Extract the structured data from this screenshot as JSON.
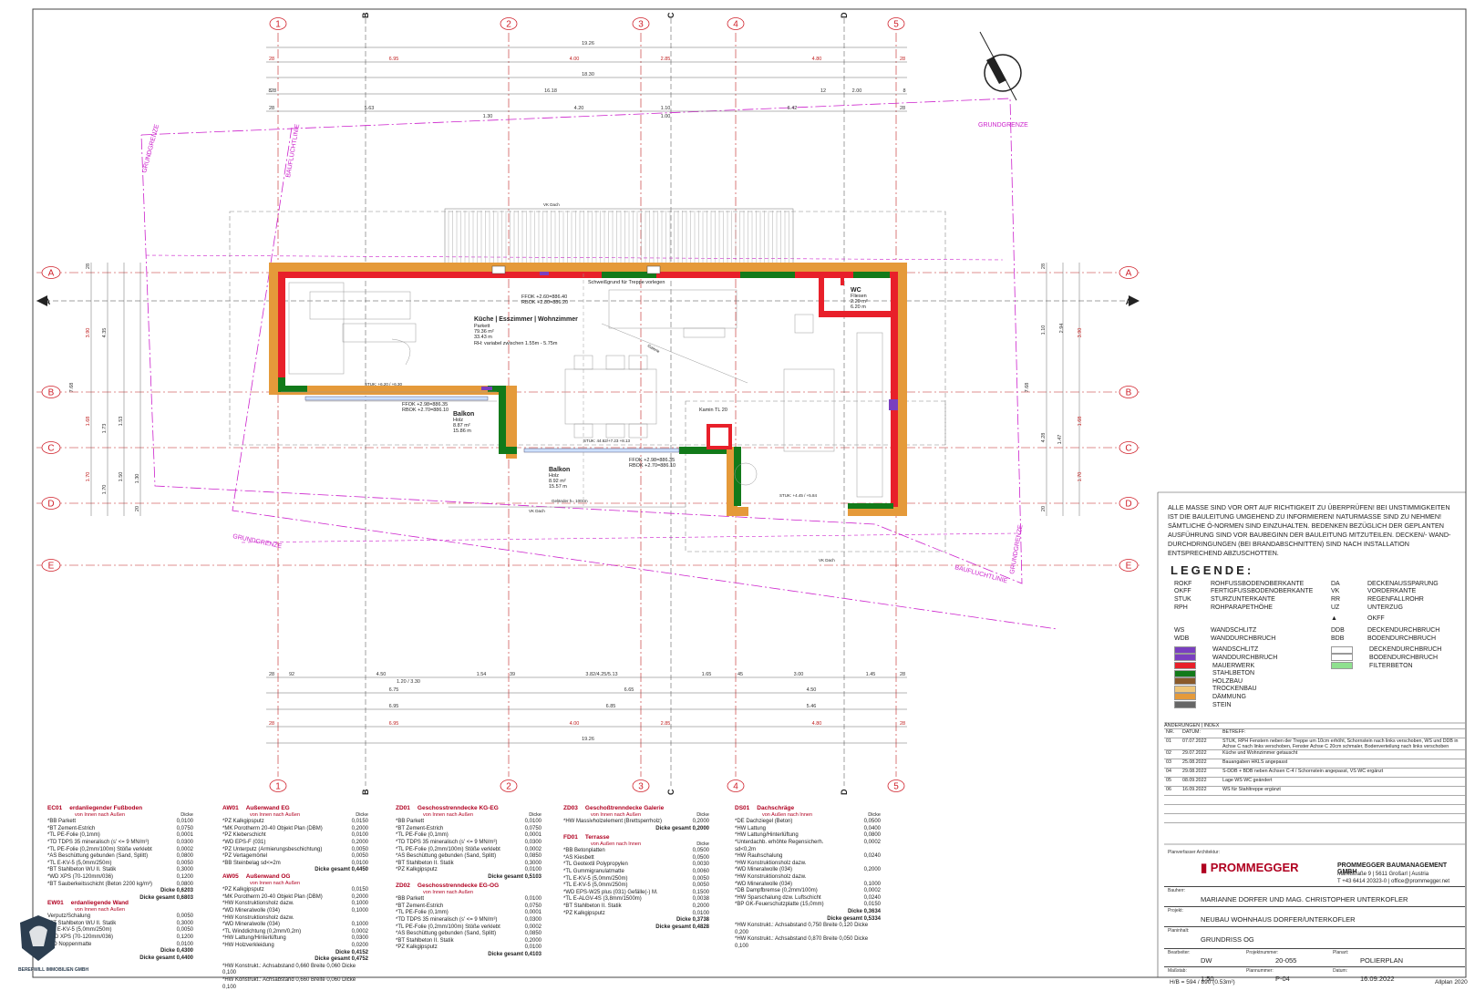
{
  "title_block": {
    "planverfasser_label": "Planverfasser Architektur:",
    "company_logo": "PROMMEGGER",
    "company_name": "PROMMEGGER BAUMANAGEMENT GMBH",
    "company_address": "Marktstraße 9 | 5611 Großarl | Austria",
    "company_contact": "T +43 6414 20323-0 | office@prommegger.net",
    "bauherr_label": "Bauherr:",
    "bauherr": "MARIANNE DORFER UND MAG. CHRISTOPHER UNTERKOFLER",
    "projekt_label": "Projekt:",
    "projekt": "NEUBAU WOHNHAUS DORFER/UNTERKOFLER",
    "planinhalt_label": "Planinhalt:",
    "planinhalt": "GRUNDRISS OG",
    "bearbeiter_label": "Bearbeiter:",
    "bearbeiter": "DW",
    "projektnummer_label": "Projektnummer:",
    "projektnummer": "20-055",
    "planart_label": "Planart:",
    "planart": "POLIERPLAN",
    "massstab_label": "Maßstab:",
    "massstab": "1:50",
    "plannummer_label": "Plannummer:",
    "plannummer": "P-04",
    "datum_label": "Datum:",
    "datum": "16.09.2022",
    "format": "H/B = 594 / 890 (0.53m²)",
    "software": "Allplan 2020"
  },
  "notes": "ALLE MASSE SIND VOR ORT AUF RICHTIGKEIT ZU ÜBERPRÜFEN! BEI UNSTIMMIGKEITEN IST DIE BAULEITUNG UMGEHEND ZU INFORMIEREN! NATURMASSE SIND ZU NEHMEN! SÄMTLICHE Ö-NORMEN SIND EINZUHALTEN. BEDENKEN BEZÜGLICH DER GEPLANTEN AUSFÜHRUNG SIND VOR BAUBEGINN DER BAULEITUNG MITZUTEILEN. DECKEN/- WAND-DURCHDRINGUNGEN (BEI BRANDABSCHNITTEN) SIND NACH INSTALLATION ENTSPRECHEND ABZUSCHOTTEN.",
  "legend": {
    "title": "LEGENDE:",
    "abbreviations_left": [
      {
        "code": "ROKF",
        "desc": "ROHFUSSBODENOBERKANTE"
      },
      {
        "code": "OKFF",
        "desc": "FERTIGFUSSBODENOBERKANTE"
      },
      {
        "code": "STUK",
        "desc": "STURZUNTERKANTE"
      },
      {
        "code": "RPH",
        "desc": "ROHPARAPETHÖHE"
      }
    ],
    "abbreviations_right": [
      {
        "code": "DA",
        "desc": "DECKENAUSSPARUNG"
      },
      {
        "code": "VK",
        "desc": "VORDERKANTE"
      },
      {
        "code": "RR",
        "desc": "REGENFALLROHR"
      },
      {
        "code": "UZ",
        "desc": "UNTERZUG"
      }
    ],
    "okff_symbol": "OKFF",
    "ws": {
      "code": "WS",
      "desc": "WANDSCHLITZ"
    },
    "wdb": {
      "code": "WDB",
      "desc": "WANDDURCHBRUCH"
    },
    "ddb": {
      "code": "DDB",
      "desc": "DECKENDURCHBRUCH"
    },
    "bdb": {
      "code": "BDB",
      "desc": "BODENDURCHBRUCH"
    },
    "materials": [
      {
        "desc": "WANDSCHLITZ",
        "color": "#7a3fc0"
      },
      {
        "desc": "WANDDURCHBRUCH",
        "color": "#7a3fc0"
      },
      {
        "desc": "MAUERWERK",
        "color": "#e8202a"
      },
      {
        "desc": "STAHLBETON",
        "color": "#127a1a"
      },
      {
        "desc": "HOLZBAU",
        "color": "#8a5a2b"
      },
      {
        "desc": "TROCKENBAU",
        "color": "#f0c77a"
      },
      {
        "desc": "DÄMMUNG",
        "color": "#e59a3a"
      },
      {
        "desc": "STEIN",
        "color": "#666666"
      }
    ],
    "materials_right": [
      {
        "desc": "DECKENDURCHBRUCH",
        "color": "#ffffff"
      },
      {
        "desc": "BODENDURCHBRUCH",
        "color": "#ffffff"
      },
      {
        "desc": "FILTERBETON",
        "color": "#8fe08f"
      }
    ]
  },
  "changes": {
    "title": "ÄNDERUNGEN | INDEX",
    "headers": [
      "NR.",
      "DATUM:",
      "BETREFF:"
    ],
    "rows": [
      {
        "nr": "01",
        "date": "07.07.2022",
        "text": "STUK, RPH Fenstern neben der Treppe um 10cm erhöht, Schornstein nach links verschoben, WS und DDB in Achse C nach links verschoben, Fenster Achse C 20cm schmaler, Bodenverteilung nach links verschoben"
      },
      {
        "nr": "02",
        "date": "29.07.2022",
        "text": "Küche und Wohnzimmer getauscht"
      },
      {
        "nr": "03",
        "date": "25.08.2022",
        "text": "Bauangaben HKLS angepasst"
      },
      {
        "nr": "04",
        "date": "29.08.2022",
        "text": "S-DDB + BDB neben Achsen C-4 / Schornstein angepasst, VS WC ergänzt"
      },
      {
        "nr": "05",
        "date": "08.09.2022",
        "text": "Lage WS WC geändert"
      },
      {
        "nr": "06",
        "date": "16.09.2022",
        "text": "WS für Stahltreppe ergänzt"
      }
    ]
  },
  "axes": {
    "numbers": [
      "1",
      "2",
      "3",
      "4",
      "5"
    ],
    "letters_top": [
      "B",
      "C",
      "D"
    ],
    "rows": [
      "A",
      "B",
      "C",
      "D",
      "E"
    ],
    "section": "A"
  },
  "dimensions_top": {
    "overall": "19.26",
    "row2": [
      "28",
      "6.95",
      "4.00",
      "2.85",
      "4.80",
      "28"
    ],
    "row3": "18.30",
    "row4": [
      "8",
      "28",
      "16.18",
      "12",
      "2.00",
      "8"
    ],
    "row5": [
      "28",
      "5.63",
      "4.20",
      "1.10",
      "6.42",
      "28"
    ],
    "row5b": [
      "1.30",
      "1.00"
    ]
  },
  "dimensions_bottom": {
    "row1": [
      "28",
      "92",
      "4.50",
      "1.54",
      "39",
      "3.82/4.25/5.13",
      "1.65",
      "45",
      "3.00",
      "1.45",
      "28"
    ],
    "row1b": "1.20 / 3.30",
    "row2": [
      "6.75",
      "6.65",
      "4.50"
    ],
    "row3": [
      "6.95",
      "6.85",
      "5.46"
    ],
    "row4": [
      "28",
      "6.95",
      "4.00",
      "2.85",
      "4.80",
      "28"
    ],
    "overall": "19.26"
  },
  "dimensions_side": {
    "left": [
      "28",
      "3.90",
      "4.35",
      "1.68",
      "1.73",
      "1.70",
      "1.70",
      "7.68",
      "1.53",
      "1.50",
      "1.30",
      "20"
    ],
    "right": [
      "28",
      "3.90",
      "2.94",
      "1.10",
      "1.68",
      "4.28",
      "7.68",
      "1.70",
      "1.47",
      "20"
    ]
  },
  "rooms": [
    {
      "name": "Küche | Esszimmer | Wohnzimmer",
      "floor": "Parkett",
      "area": "79.36 m²",
      "perimeter": "33.43 m",
      "rh": "RH: variabel zwischen 1.55m - 5.75m"
    },
    {
      "name": "WC",
      "floor": "Fliesen",
      "area": "2.20 m²",
      "perimeter": "6.20 m"
    },
    {
      "name": "Balkon",
      "floor": "Holz",
      "area": "8.87 m²",
      "perimeter": "15.86 m"
    },
    {
      "name": "Balkon",
      "floor": "Holz",
      "area": "8.92 m²",
      "perimeter": "15.57 m"
    }
  ],
  "labels": {
    "grundgrenze": "GRUNDGRENZE",
    "baufluchtlinie": "BAUFLUCHTLINIE",
    "vk_dach": "VK Dach",
    "kamin": "Kamin TL 20",
    "gelaender": "Geländer h= 100cm",
    "ffok1": "FFOK +2.60=886.40",
    "rbok1": "RBOK +2.80=886.20",
    "ffok2": "FFOK +2.98=886.35",
    "rbok2": "RBOK +2.70=886.10",
    "ffok3": "FFOK +2.98=886.35",
    "rbok3": "RBOK +2.70=886.10",
    "treppe": "Schweißgrund für Treppe vorlegen",
    "stuk1": "STUK: +6.20 / +6.30",
    "stuk2": "STUK: +4.45 / +5.84",
    "stuk3": "STUK: 44.62/+7.23 +8.13",
    "galerie": "Galerie"
  },
  "layers": {
    "ec01": {
      "code": "EC01",
      "title": "erdanliegender Fußboden",
      "sub": "von Innen nach Außen",
      "dicke_label": "Dicke",
      "rows": [
        [
          "*BB Parkett",
          "0,0100"
        ],
        [
          "*BT Zement-Estrich",
          "0,0750"
        ],
        [
          "*TL PE-Folie (0,1mm)",
          "0,0001"
        ],
        [
          "*TD TDPS 35 mineralisch (s' <= 9 MN/m³)",
          "0,0300"
        ],
        [
          "*TL PE-Folie (0,2mm/100m) Stöße verklebt",
          "0,0002"
        ],
        [
          "*AS Beschüttung gebunden (Sand, Splitt)",
          "0,0800"
        ],
        [
          "*TL E-KV-5 (5,0mm/250m)",
          "0,0050"
        ],
        [
          "*BT Stahlbeton WU II. Statik",
          "0,3000"
        ],
        [
          "*WD XPS (70-120mm/036)",
          "0,1200"
        ],
        [
          "*BT Sauberkeitsschicht (Beton 2200 kg/m³)",
          "0,0800"
        ]
      ],
      "dicke": "Dicke 0,6203",
      "gesamt": "Dicke gesamt 0,6803"
    },
    "ew01": {
      "code": "EW01",
      "title": "erdanliegende Wand",
      "sub": "von Innen nach Außen",
      "rows": [
        [
          "Verputz/Schalung",
          "0,0050"
        ],
        [
          "*BT Stahlbeton WU II. Statik",
          "0,3000"
        ],
        [
          "*TL E-KV-5 (5,0mm/250m)",
          "0,0050"
        ],
        [
          "*WD XPS (70-120mm/036)",
          "0,1200"
        ],
        [
          "*SD Noppenmatte",
          "0,0100"
        ]
      ],
      "dicke": "Dicke 0,4300",
      "gesamt": "Dicke gesamt 0,4400"
    },
    "aw01": {
      "code": "AW01",
      "title": "Außenwand EG",
      "sub": "von Innen nach Außen",
      "dicke_label": "Dicke",
      "rows": [
        [
          "*PZ Kalkgipsputz",
          "0,0150"
        ],
        [
          "*MK Porotherm 20-40 Objekt Plan (DBM)",
          "0,2000"
        ],
        [
          "*PZ Kleberschicht",
          "0,0100"
        ],
        [
          "*WD EPS-F (031)",
          "0,2000"
        ],
        [
          "*PZ Unterputz (Armierungsbeschichtung)",
          "0,0050"
        ],
        [
          "*PZ Vertagemörtel",
          "0,0050"
        ],
        [
          "*BB Steinbelag sd<=2m",
          "0,0100"
        ]
      ],
      "gesamt": "Dicke gesamt 0,4450"
    },
    "aw05": {
      "code": "AW05",
      "title": "Außenwand OG",
      "sub": "von Innen nach Außen",
      "rows": [
        [
          "*PZ Kalkgipsputz",
          "0,0150"
        ],
        [
          "*MK Porotherm 20-40 Objekt Plan (DBM)",
          "0,2000"
        ],
        [
          "*HW Konstruktionsholz dazw.",
          "0,1000"
        ],
        [
          "  *WD Mineralwolle (034)",
          "0,1000"
        ],
        [
          "*HW Konstruktionsholz dazw.",
          ""
        ],
        [
          "  *WD Mineralwolle (034)",
          "0,1000"
        ],
        [
          "*TL Winddichtung (0,2mm/0,2m)",
          "0,0002"
        ],
        [
          "*HW Lattung/Hinterlüftung",
          "0,0300"
        ],
        [
          "*HW Holzverkleidung",
          "0,0200"
        ]
      ],
      "dicke": "Dicke 0,4152",
      "gesamt": "Dicke gesamt 0,4752",
      "foot": [
        "*HW Konstrukt.: Achsabstand 0,660  Breite 0,060  Dicke 0,100",
        "*HW Konstrukt.: Achsabstand 0,660  Breite 0,060  Dicke 0,100"
      ]
    },
    "zd01": {
      "code": "ZD01",
      "title": "Geschosstrenndecke KG-EG",
      "sub": "von Innen nach Außen",
      "dicke_label": "Dicke",
      "rows": [
        [
          "*BB Parkett",
          "0,0100"
        ],
        [
          "*BT Zement-Estrich",
          "0,0750"
        ],
        [
          "*TL PE-Folie (0,1mm)",
          "0,0001"
        ],
        [
          "*TD TDPS 35 mineralisch (s' <= 9 MN/m³)",
          "0,0300"
        ],
        [
          "*TL PE-Folie (0,2mm/100m) Stöße verklebt",
          "0,0002"
        ],
        [
          "*AS Beschüttung gebunden (Sand, Splitt)",
          "0,0850"
        ],
        [
          "*BT Stahlbeton II. Statik",
          "0,3000"
        ],
        [
          "*PZ Kalkgipsputz",
          "0,0100"
        ]
      ],
      "gesamt": "Dicke gesamt 0,5103"
    },
    "zd02": {
      "code": "ZD02",
      "title": "Geschosstrenndecke EG-OG",
      "sub": "von Innen nach Außen",
      "rows": [
        [
          "*BB Parkett",
          "0,0100"
        ],
        [
          "*BT Zement-Estrich",
          "0,0750"
        ],
        [
          "*TL PE-Folie (0,1mm)",
          "0,0001"
        ],
        [
          "*TD TDPS 35 mineralisch (s' <= 9 MN/m³)",
          "0,0300"
        ],
        [
          "*TL PE-Folie (0,2mm/100m) Stöße verklebt",
          "0,0002"
        ],
        [
          "*AS Beschüttung gebunden (Sand, Splitt)",
          "0,0850"
        ],
        [
          "*BT Stahlbeton II. Statik",
          "0,2000"
        ],
        [
          "*PZ Kalkgipsputz",
          "0,0100"
        ]
      ],
      "gesamt": "Dicke gesamt 0,4103"
    },
    "zd03": {
      "code": "ZD03",
      "title": "Geschoßtrenndecke Galerie",
      "sub": "von Innen nach Außen",
      "dicke_label": "Dicke",
      "rows": [
        [
          "*HW Massivholzelement (Brettsperrholz)",
          "0,2000"
        ]
      ],
      "gesamt": "Dicke gesamt 0,2000"
    },
    "fd01": {
      "code": "FD01",
      "title": "Terrasse",
      "sub": "von Außen nach Innen",
      "dicke_label": "Dicke",
      "rows": [
        [
          "*BB Betonplatten",
          "0,0500"
        ],
        [
          "*AS Kiesbett",
          "0,0500"
        ],
        [
          "*TL Geotextil Polypropylen",
          "0,0030"
        ],
        [
          "*TL Gummigranulatmatte",
          "0,0060"
        ],
        [
          "*TL E-KV-5 (5,0mm/250m)",
          "0,0050"
        ],
        [
          "*TL E-KV-5 (5,0mm/250m)",
          "0,0050"
        ],
        [
          "*WD EPS-W25 plus (031) Gefälle(-) M.",
          "0,1500"
        ],
        [
          "*TL E-ALGV-4S (3,8mm/1500m)",
          "0,0038"
        ],
        [
          "*BT Stahlbeton II. Statik",
          "0,2000"
        ],
        [
          "*PZ Kalkgipsputz",
          "0,0100"
        ]
      ],
      "dicke": "Dicke 0,3738",
      "gesamt": "Dicke gesamt 0,4828"
    },
    "ds01": {
      "code": "DS01",
      "title": "Dachschräge",
      "sub": "von Außen nach Innen",
      "dicke_label": "Dicke",
      "rows": [
        [
          "*DE Dachziegel (Beton)",
          "0,0500"
        ],
        [
          "*HW Lattung",
          "0,0400"
        ],
        [
          "*HW Lattung/Hinterlüftung",
          "0,0800"
        ],
        [
          "*Unterdachb. erhöhte Regensicherh. sd<0,2m",
          "0,0002"
        ],
        [
          "*HW Rauhschalung",
          "0,0240"
        ],
        [
          "*HW Konstruktionsholz dazw.",
          ""
        ],
        [
          "  *WD Mineralwolle (034)",
          "0,2000"
        ],
        [
          "*HW Konstruktionsholz dazw.",
          ""
        ],
        [
          "  *WD Mineralwolle (034)",
          "0,1000"
        ],
        [
          "*DB Dampfbremse (0,2mm/100m)",
          "0,0002"
        ],
        [
          "*HW Sparschalung dzw. Luftschicht",
          "0,0240"
        ],
        [
          "*BP GK-Feuerschutzplatte (15,0mm)",
          "0,0150"
        ]
      ],
      "dicke": "Dicke 0,3634",
      "gesamt": "Dicke gesamt 0,5334",
      "foot": [
        "*HW Konstrukt.: Achsabstand 0,750  Breite 0,120  Dicke 0,200",
        "*HW Konstrukt.: Achsabstand 0,870  Breite 0,050  Dicke 0,100"
      ]
    }
  },
  "footer_logo": "BEREFWILL IMMOBILIEN GMBH",
  "colors": {
    "masonry": "#e8202a",
    "concrete": "#127a1a",
    "insulation": "#e59a3a",
    "drywall": "#f0c77a",
    "axis": "#d0202a",
    "dim": "#c02020",
    "magenta": "#cc22cc",
    "purple": "#7a3fc0"
  }
}
